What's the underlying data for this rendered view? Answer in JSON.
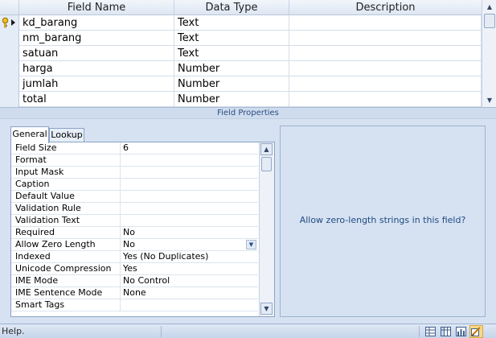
{
  "grid": {
    "headers": [
      "Field Name",
      "Data Type",
      "Description"
    ],
    "rows": [
      {
        "name": "kd_barang",
        "type": "Text",
        "description": ""
      },
      {
        "name": "nm_barang",
        "type": "Text",
        "description": ""
      },
      {
        "name": "satuan",
        "type": "Text",
        "description": ""
      },
      {
        "name": "harga",
        "type": "Number",
        "description": ""
      },
      {
        "name": "jumlah",
        "type": "Number",
        "description": ""
      },
      {
        "name": "total",
        "type": "Number",
        "description": ""
      }
    ],
    "primary_key_row": 0
  },
  "field_properties": {
    "title": "Field Properties",
    "tabs": [
      "General",
      "Lookup"
    ],
    "active_tab": "General",
    "properties": [
      {
        "label": "Field Size",
        "value": "6"
      },
      {
        "label": "Format",
        "value": ""
      },
      {
        "label": "Input Mask",
        "value": ""
      },
      {
        "label": "Caption",
        "value": ""
      },
      {
        "label": "Default Value",
        "value": ""
      },
      {
        "label": "Validation Rule",
        "value": ""
      },
      {
        "label": "Validation Text",
        "value": ""
      },
      {
        "label": "Required",
        "value": "No"
      },
      {
        "label": "Allow Zero Length",
        "value": "No"
      },
      {
        "label": "Indexed",
        "value": "Yes (No Duplicates)"
      },
      {
        "label": "Unicode Compression",
        "value": "Yes"
      },
      {
        "label": "IME Mode",
        "value": "No Control"
      },
      {
        "label": "IME Sentence Mode",
        "value": "None"
      },
      {
        "label": "Smart Tags",
        "value": ""
      }
    ],
    "dropdown_row": 8,
    "help_text": "Allow zero-length strings in this field?"
  },
  "status_bar": {
    "text": "Help.",
    "view_icons": [
      "datasheet-view-icon",
      "pivottable-view-icon",
      "pivotchart-view-icon",
      "design-view-icon"
    ],
    "active_view": "design-view-icon"
  },
  "colors": {
    "accent": "#2b4d80",
    "panel_bg": "#d6e2f2",
    "help_text": "#1f4a82"
  }
}
